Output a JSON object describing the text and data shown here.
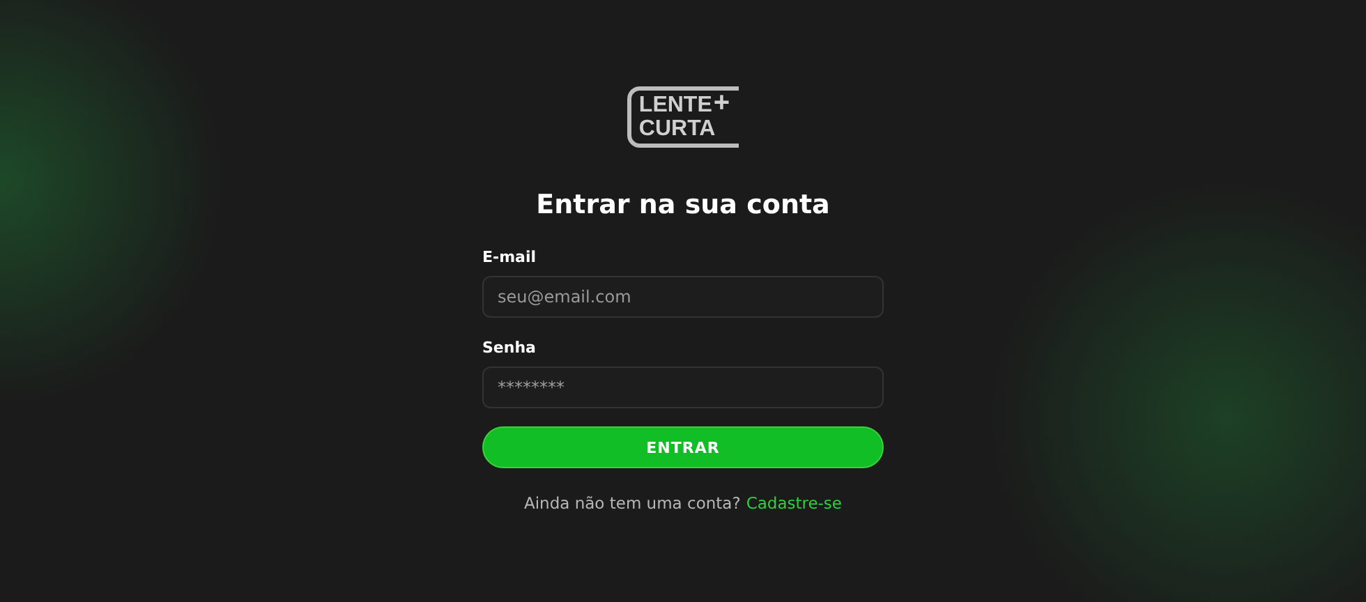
{
  "logo": {
    "line_1": "LENTE",
    "plus": "+",
    "line_2": "CURTA"
  },
  "title": "Entrar na sua conta",
  "fields": [
    {
      "label": "E-mail",
      "placeholder": "seu@email.com"
    },
    {
      "label": "Senha",
      "placeholder": "********"
    }
  ],
  "submit": "ENTRAR",
  "signup": {
    "prompt": "Ainda não tem uma conta?",
    "link": "Cadastre-se"
  }
}
